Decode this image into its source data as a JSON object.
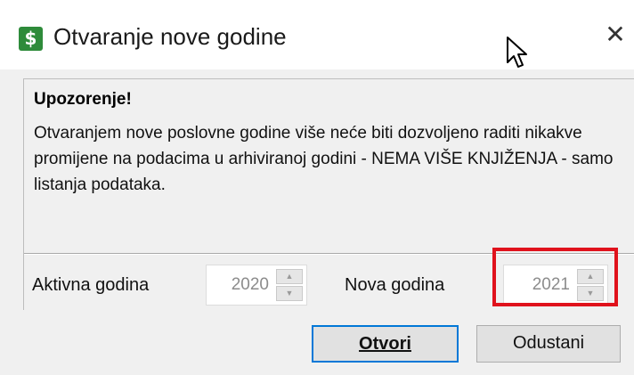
{
  "window": {
    "icon_symbol": "$",
    "icon_name": "app-dollar-icon",
    "title": "Otvaranje nove godine",
    "close_symbol": "✕"
  },
  "warning": {
    "title": "Upozorenje!",
    "message": "Otvaranjem nove poslovne godine više neće biti dozvoljeno raditi nikakve promijene na podacima u arhiviranoj godini - NEMA VIŠE KNJIŽENJA - samo listanja podataka."
  },
  "fields": {
    "active_year_label": "Aktivna godina",
    "active_year_value": "2020",
    "new_year_label": "Nova godina",
    "new_year_value": "2021"
  },
  "buttons": {
    "open_label": "Otvori",
    "cancel_label": "Odustani"
  },
  "colors": {
    "icon_bg": "#2e8b3a",
    "highlight": "#e0121c",
    "default_button_border": "#0078d7"
  }
}
